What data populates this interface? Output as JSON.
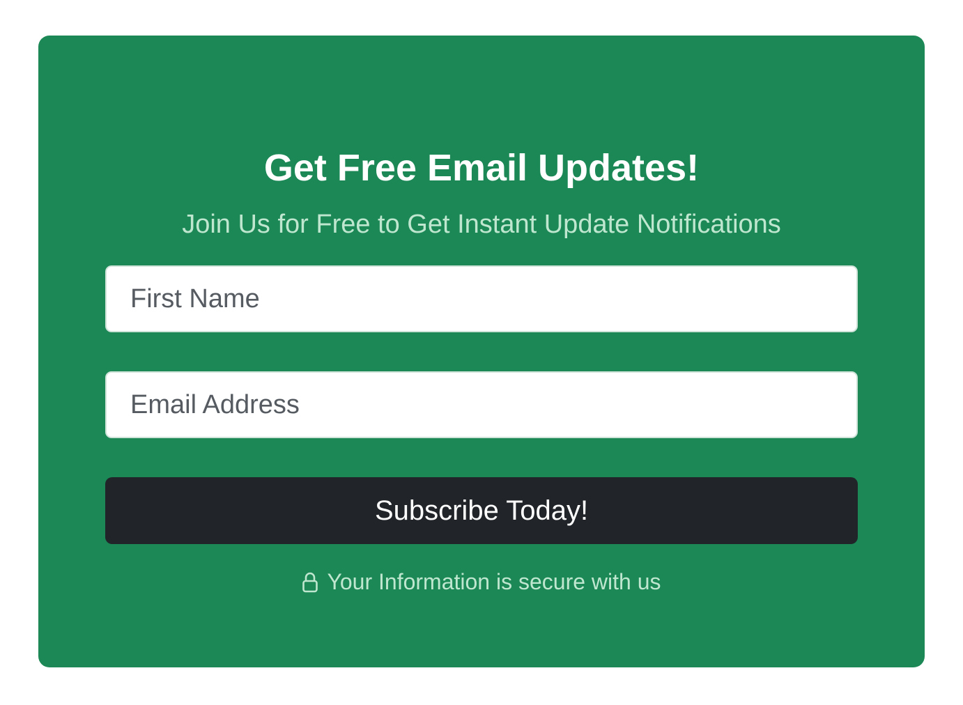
{
  "signup": {
    "title": "Get Free Email Updates!",
    "subtitle": "Join Us for Free to Get Instant Update Notifications",
    "first_name_placeholder": "First Name",
    "first_name_value": "",
    "email_placeholder": "Email Address",
    "email_value": "",
    "subscribe_label": "Subscribe Today!",
    "security_note": "Your Information is secure with us",
    "security_icon": "lock-icon"
  },
  "colors": {
    "card_background": "#1b8856",
    "subtitle_text": "#bfe6cf",
    "button_background": "#212529",
    "button_text": "#ffffff"
  }
}
